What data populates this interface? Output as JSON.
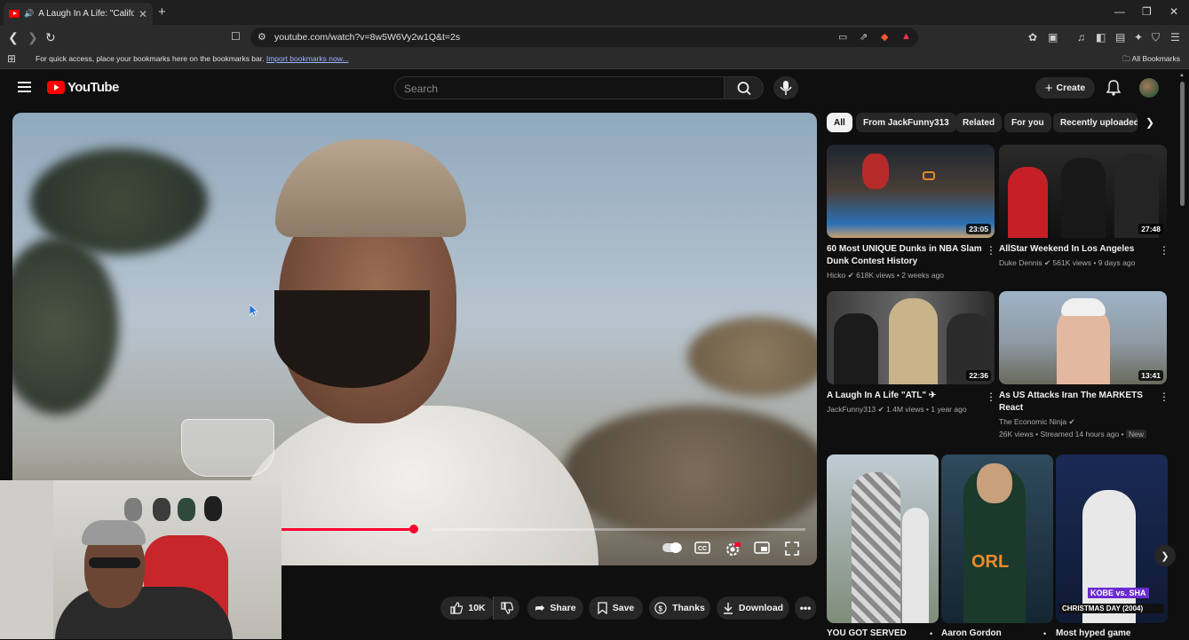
{
  "browser": {
    "tab_title": "A Laugh In A Life: \"California",
    "url": "youtube.com/watch?v=8w5W6Vy2w1Q&t=2s",
    "bookmarks_message": "For quick access, place your bookmarks here on the bookmarks bar.",
    "import_link": "Import bookmarks now...",
    "all_bookmarks": "All Bookmarks"
  },
  "masthead": {
    "logo_text": "YouTube",
    "search_placeholder": "Search",
    "create_label": "Create"
  },
  "actions": {
    "like_count": "10K",
    "share": "Share",
    "save": "Save",
    "thanks": "Thanks",
    "download": "Download"
  },
  "chips": [
    "All",
    "From JackFunny313",
    "Related",
    "For you",
    "Recently uploaded"
  ],
  "recommendations": [
    {
      "title_line1": "60 Most UNIQUE Dunks in NBA Slam",
      "title_line2": "Dunk Contest History",
      "channel": "Hicko",
      "meta": "618K views • 2 weeks ago",
      "duration": "23:05"
    },
    {
      "title_line1": "AllStar Weekend In Los Angeles",
      "title_line2": "",
      "channel": "Duke Dennis",
      "meta": "561K views • 9 days ago",
      "duration": "27:48"
    },
    {
      "title_line1": "A Laugh In A Life \"ATL\" ✈",
      "title_line2": "",
      "channel": "JackFunny313",
      "meta": "1.4M views • 1 year ago",
      "duration": "22:36"
    },
    {
      "title_line1": "As US Attacks Iran The MARKETS",
      "title_line2": "React",
      "channel": "The Economic Ninja",
      "meta": "26K views • Streamed 14 hours ago",
      "badge": "New",
      "duration": "13:41"
    }
  ],
  "shorts": [
    {
      "title": "YOU GOT SERVED"
    },
    {
      "title": "Aaron Gordon"
    },
    {
      "title": "Most hyped game"
    }
  ],
  "shorts_overlay_text": "KOBE vs. SHA",
  "shorts_overlay_sub": "CHRISTMAS DAY (2004)",
  "jersey_text": "ORL",
  "colors": {
    "accent": "#ff0033",
    "brand": "#ff0000",
    "background": "#0f0f0f"
  }
}
